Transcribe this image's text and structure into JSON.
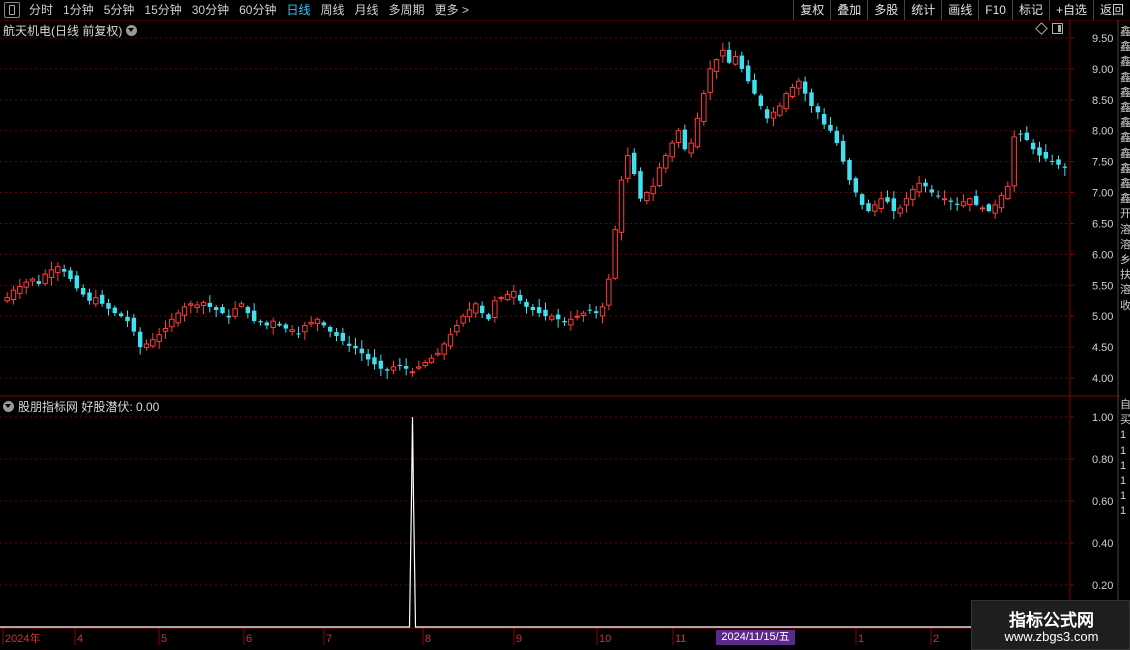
{
  "toolbar": {
    "periods": [
      "分时",
      "1分钟",
      "5分钟",
      "15分钟",
      "30分钟",
      "60分钟",
      "日线",
      "周线",
      "月线",
      "多周期",
      "更多 >"
    ],
    "active_period": "日线",
    "right_buttons": [
      "复权",
      "叠加",
      "多股",
      "统计",
      "画线",
      "F10",
      "标记",
      "+自选",
      "返回"
    ]
  },
  "stock": {
    "title": "航天机电(日线 前复权)"
  },
  "indicator": {
    "title": "股朋指标网 好股潜伏: 0.00"
  },
  "main_axis": {
    "labels": [
      "9.50",
      "9.00",
      "8.50",
      "8.00",
      "7.50",
      "7.00",
      "6.50",
      "6.00",
      "5.50",
      "5.00",
      "4.50",
      "4.00"
    ]
  },
  "ind_axis": {
    "labels": [
      "1.00",
      "0.80",
      "0.60",
      "0.40",
      "0.20"
    ]
  },
  "x_axis": {
    "labels": [
      "2024年",
      "4",
      "5",
      "6",
      "7",
      "8",
      "9",
      "10",
      "11",
      "1",
      "2"
    ]
  },
  "date_tag": "2024/11/15/五",
  "side_top": "鑫鑫鑫鑫鑫鑫鑫鑫鑫鑫鑫鑫开溶溶乡扶溶收",
  "side_bottom": "自买111111",
  "watermark": {
    "title": "指标公式网",
    "url": "www.zbgs3.com"
  },
  "colors": {
    "up": "#ff3c3c",
    "down": "#40e0f0",
    "grid": "#6a0000",
    "axis": "#8a0000",
    "signal": "#ffffff"
  },
  "chart_data": {
    "type": "candlestick",
    "price_range": [
      3.85,
      9.62
    ],
    "indicator_range": [
      0,
      1.0
    ],
    "close": [
      5.3,
      5.42,
      5.48,
      5.55,
      5.6,
      5.52,
      5.68,
      5.75,
      5.8,
      5.72,
      5.6,
      5.45,
      5.35,
      5.25,
      5.3,
      5.2,
      5.12,
      5.05,
      5.0,
      4.92,
      4.75,
      4.5,
      4.55,
      4.62,
      4.7,
      4.8,
      4.95,
      5.05,
      5.15,
      5.2,
      5.18,
      5.22,
      5.15,
      5.1,
      5.05,
      4.98,
      5.12,
      5.2,
      5.05,
      4.92,
      4.9,
      4.85,
      4.92,
      4.85,
      4.8,
      4.78,
      4.72,
      4.85,
      4.9,
      4.95,
      4.85,
      4.75,
      4.68,
      4.6,
      4.52,
      4.48,
      4.4,
      4.3,
      4.22,
      4.15,
      4.12,
      4.18,
      4.2,
      4.15,
      4.1,
      4.18,
      4.25,
      4.32,
      4.4,
      4.55,
      4.7,
      4.85,
      5.0,
      5.1,
      5.2,
      5.05,
      4.95,
      5.25,
      5.3,
      5.35,
      5.4,
      5.25,
      5.15,
      5.1,
      5.05,
      5.0,
      5.0,
      4.95,
      4.9,
      4.95,
      5.0,
      5.05,
      5.1,
      5.05,
      5.15,
      5.6,
      6.4,
      7.2,
      7.6,
      7.3,
      6.9,
      7.0,
      7.1,
      7.4,
      7.6,
      7.8,
      8.0,
      7.7,
      7.8,
      8.2,
      8.6,
      9.0,
      9.15,
      9.3,
      9.1,
      9.2,
      9.0,
      8.8,
      8.6,
      8.4,
      8.2,
      8.3,
      8.4,
      8.6,
      8.7,
      8.8,
      8.6,
      8.4,
      8.3,
      8.1,
      8.0,
      7.8,
      7.5,
      7.2,
      7.0,
      6.8,
      6.7,
      6.8,
      6.9,
      6.85,
      6.7,
      6.75,
      6.9,
      7.05,
      7.15,
      7.1,
      7.0,
      6.95,
      6.9,
      6.85,
      6.8,
      6.85,
      6.9,
      6.8,
      6.75,
      6.7,
      6.8,
      6.95,
      7.1,
      7.9,
      7.95,
      7.85,
      7.7,
      7.6,
      7.55,
      7.5,
      7.45,
      7.4
    ],
    "signal_index": 64,
    "signal_value": 1.0
  }
}
